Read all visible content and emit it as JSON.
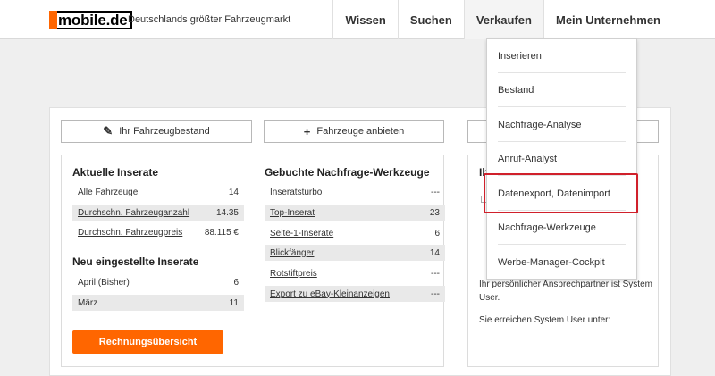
{
  "header": {
    "logo_text": "mobile.de",
    "tagline": "Deutschlands größter Fahrzeugmarkt",
    "nav": [
      {
        "label": "Wissen"
      },
      {
        "label": "Suchen"
      },
      {
        "label": "Verkaufen"
      },
      {
        "label": "Mein Unternehmen"
      }
    ]
  },
  "actions": {
    "stock_label": "Ihr Fahrzeugbestand",
    "offer_label": "Fahrzeuge anbieten"
  },
  "current_listings": {
    "title": "Aktuelle Inserate",
    "rows": [
      {
        "label": "Alle Fahrzeuge",
        "value": "14"
      },
      {
        "label": "Durchschn. Fahrzeuganzahl",
        "value": "14.35"
      },
      {
        "label": "Durchschn. Fahrzeugpreis",
        "value": "88.115 €"
      }
    ]
  },
  "new_listings": {
    "title": "Neu eingestellte Inserate",
    "rows": [
      {
        "label": "April (Bisher)",
        "value": "6"
      },
      {
        "label": "März",
        "value": "11"
      }
    ]
  },
  "invoice_button": "Rechnungsübersicht",
  "booked_tools": {
    "title": "Gebuchte Nachfrage-Werkzeuge",
    "rows": [
      {
        "label": "Inseratsturbo",
        "value": "---"
      },
      {
        "label": "Top-Inserat",
        "value": "23"
      },
      {
        "label": "Seite-1-Inserate",
        "value": "6"
      },
      {
        "label": "Blickfänger",
        "value": "14"
      },
      {
        "label": "Rotstiftpreis",
        "value": "---"
      },
      {
        "label": "Export zu eBay-Kleinanzeigen",
        "value": "---"
      }
    ]
  },
  "contact": {
    "title_fragment": "Ih",
    "text1": "Ihr persönlicher Ansprechpartner ist System User.",
    "text2": "Sie erreichen System User unter:"
  },
  "dropdown": {
    "items": [
      {
        "label": "Inserieren"
      },
      {
        "label": "Bestand"
      },
      {
        "label": "Nachfrage-Analyse"
      },
      {
        "label": "Anruf-Analyst"
      },
      {
        "label": "Datenexport, Datenimport"
      },
      {
        "label": "Nachfrage-Werkzeuge"
      },
      {
        "label": "Werbe-Manager-Cockpit"
      }
    ]
  },
  "colors": {
    "brand_orange": "#ff6600",
    "highlight_red": "#d0202b"
  },
  "icons": {
    "pencil": "pencil-icon",
    "plus": "plus-icon"
  }
}
